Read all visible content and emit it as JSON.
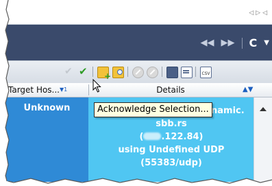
{
  "tooltip": {
    "text": "Acknowledge Selection..."
  },
  "table": {
    "columns": [
      {
        "label": "Target Hos...",
        "sort": "▼1"
      },
      {
        "label": "Details"
      }
    ],
    "row": {
      "target": "Unknown",
      "details": {
        "line1": "cable-188-2-122-84.dynamic.",
        "line2": "sbb.rs",
        "line3_prefix": "(",
        "line3_suffix": ".122.84)",
        "line4": "using Undefined UDP",
        "line5": "(55383/udp)"
      }
    }
  },
  "nav": {
    "refresh_glyph": "C"
  },
  "toolbar": {
    "csv_label": "CSV"
  },
  "colors": {
    "navbar": "#3a4a6b",
    "selected_target": "#2f8ad6",
    "selected_details": "#50c6f2",
    "tooltip_bg": "#ffffe1"
  }
}
